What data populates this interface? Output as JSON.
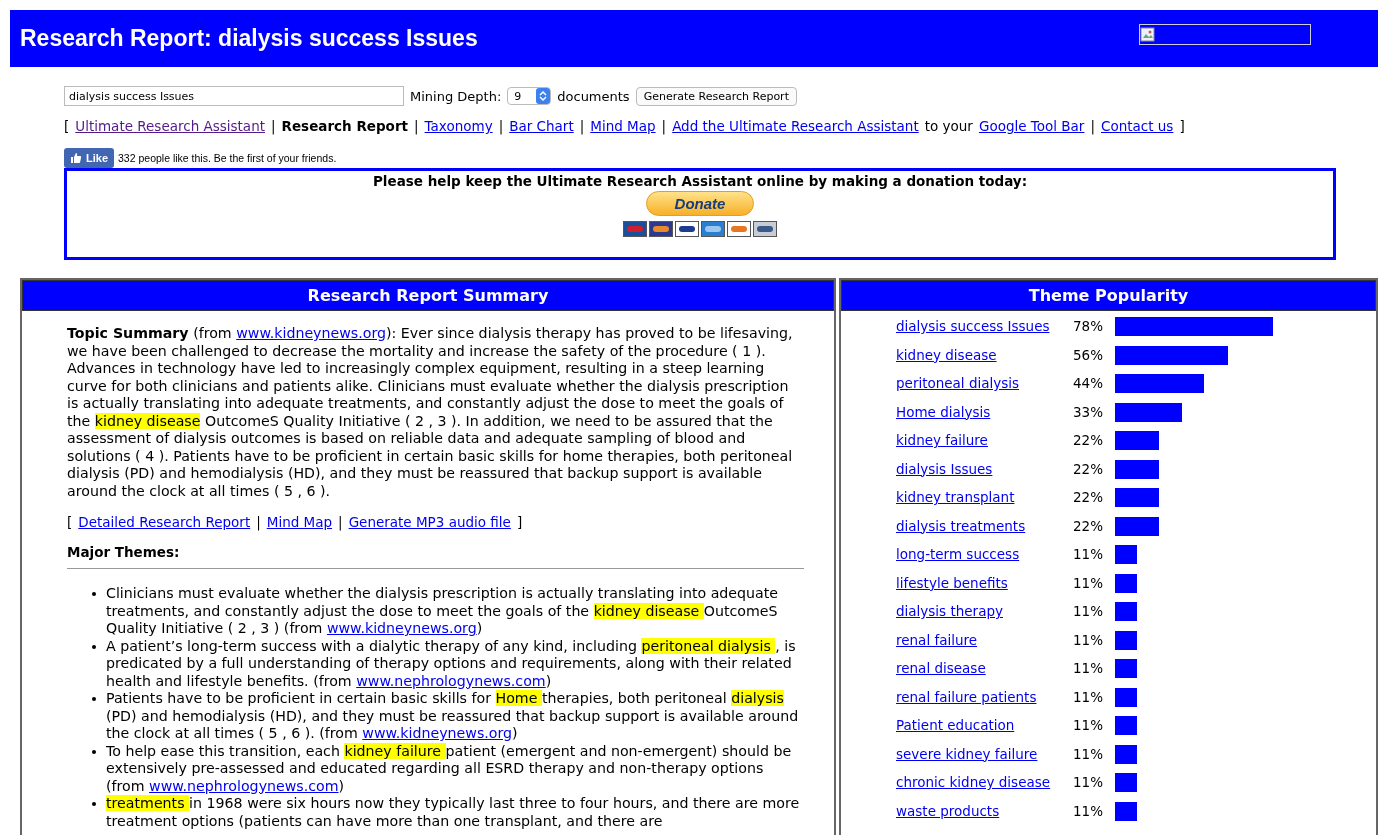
{
  "header": {
    "title": "Research Report: dialysis success Issues"
  },
  "search_form": {
    "query": "dialysis success Issues",
    "depth_label": "Mining Depth:",
    "depth_value": "9",
    "depth_unit": "documents",
    "submit": "Generate Research Report"
  },
  "nav": [
    {
      "label": "[",
      "kind": "separator"
    },
    {
      "label": "Ultimate Research Assistant",
      "kind": "link",
      "visited": true
    },
    {
      "label": "|",
      "kind": "separator"
    },
    {
      "label": "Research Report",
      "kind": "current"
    },
    {
      "label": "|",
      "kind": "separator"
    },
    {
      "label": "Taxonomy",
      "kind": "link",
      "visited": false
    },
    {
      "label": "|",
      "kind": "separator"
    },
    {
      "label": "Bar Chart",
      "kind": "link",
      "visited": false
    },
    {
      "label": "|",
      "kind": "separator"
    },
    {
      "label": "Mind Map",
      "kind": "link",
      "visited": false
    },
    {
      "label": "|",
      "kind": "separator"
    },
    {
      "label": "Add the Ultimate Research Assistant",
      "kind": "link",
      "visited": false
    },
    {
      "label": "to your",
      "kind": "text"
    },
    {
      "label": "Google Tool Bar",
      "kind": "link",
      "visited": false
    },
    {
      "label": "|",
      "kind": "separator"
    },
    {
      "label": "Contact us",
      "kind": "link",
      "visited": false
    },
    {
      "label": "]",
      "kind": "separator"
    }
  ],
  "like": {
    "button": "Like",
    "text": "332 people like this. Be the first of your friends."
  },
  "donation": {
    "message": "Please help keep the Ultimate Research Assistant online by making a donation today:",
    "button": "Donate"
  },
  "summary_panel": {
    "title": "Research Report Summary",
    "topic_summary": [
      {
        "kind": "bold",
        "text": "Topic Summary"
      },
      {
        "kind": "text",
        "text": " (from "
      },
      {
        "kind": "link",
        "text": "www.kidneynews.org"
      },
      {
        "kind": "text",
        "text": "): Ever since dialysis therapy has proved to be lifesaving, we have been challenged to decrease the mortality and increase the safety of the procedure ( 1 ). Advances in technology have led to increasingly complex equipment, resulting in a steep learning curve for both clinicians and patients alike. Clinicians must evaluate whether the dialysis prescription is actually translating into adequate treatments, and constantly adjust the dose to meet the goals of the "
      },
      {
        "kind": "highlight",
        "text": "kidney disease"
      },
      {
        "kind": "text",
        "text": " OutcomeS Quality Initiative ( 2 , 3 ). In addition, we need to be assured that the assessment of dialysis outcomes is based on reliable data and adequate sampling of blood and solutions ( 4 ). Patients have to be proficient in certain basic skills for home therapies, both peritoneal dialysis (PD) and hemodialysis (HD), and they must be reassured that backup support is available around the clock at all times ( 5 , 6 )."
      }
    ],
    "links": [
      {
        "label": "[",
        "kind": "separator"
      },
      {
        "label": "Detailed Research Report",
        "kind": "link"
      },
      {
        "label": "|",
        "kind": "separator"
      },
      {
        "label": "Mind Map",
        "kind": "link"
      },
      {
        "label": "|",
        "kind": "separator"
      },
      {
        "label": "Generate MP3 audio file",
        "kind": "link"
      },
      {
        "label": "]",
        "kind": "separator"
      }
    ],
    "themes_heading": "Major Themes:",
    "themes": [
      [
        {
          "kind": "text",
          "text": "Clinicians must evaluate whether the dialysis prescription is actually translating into adequate treatments, and constantly adjust the dose to meet the goals of the "
        },
        {
          "kind": "highlight",
          "text": "kidney disease "
        },
        {
          "kind": "text",
          "text": "OutcomeS Quality Initiative ( 2 , 3 ) (from "
        },
        {
          "kind": "link",
          "text": "www.kidneynews.org"
        },
        {
          "kind": "text",
          "text": ")"
        }
      ],
      [
        {
          "kind": "text",
          "text": "A patient’s long-term success with a dialytic therapy of any kind, including "
        },
        {
          "kind": "highlight",
          "text": "peritoneal dialysis "
        },
        {
          "kind": "text",
          "text": ", is predicated by a full understanding of therapy options and requirements, along with their related health and lifestyle benefits. (from "
        },
        {
          "kind": "link",
          "text": "www.nephrologynews.com"
        },
        {
          "kind": "text",
          "text": ")"
        }
      ],
      [
        {
          "kind": "text",
          "text": "Patients have to be proficient in certain basic skills for "
        },
        {
          "kind": "highlight",
          "text": "Home "
        },
        {
          "kind": "text",
          "text": "therapies, both peritoneal "
        },
        {
          "kind": "highlight",
          "text": "dialysis "
        },
        {
          "kind": "text",
          "text": "(PD) and hemodialysis (HD), and they must be reassured that backup support is available around the clock at all times ( 5 , 6 ). (from "
        },
        {
          "kind": "link",
          "text": "www.kidneynews.org"
        },
        {
          "kind": "text",
          "text": ")"
        }
      ],
      [
        {
          "kind": "text",
          "text": "To help ease this transition, each "
        },
        {
          "kind": "highlight",
          "text": "kidney failure "
        },
        {
          "kind": "text",
          "text": "patient (emergent and non-emergent) should be extensively pre-assessed and educated regarding all ESRD therapy and non-therapy options (from "
        },
        {
          "kind": "link",
          "text": "www.nephrologynews.com"
        },
        {
          "kind": "text",
          "text": ")"
        }
      ],
      [
        {
          "kind": "highlight",
          "text": "treatments "
        },
        {
          "kind": "text",
          "text": "in 1968 were six hours now they typically last three to four hours, and there are more treatment options (patients can have more than one transplant, and there are"
        }
      ]
    ]
  },
  "theme_panel": {
    "title": "Theme Popularity",
    "themes": [
      {
        "label": "dialysis success Issues",
        "percent": "78%",
        "level": 0.78
      },
      {
        "label": "kidney disease",
        "percent": "56%",
        "level": 0.56
      },
      {
        "label": "peritoneal dialysis",
        "percent": "44%",
        "level": 0.44
      },
      {
        "label": "Home dialysis",
        "percent": "33%",
        "level": 0.33
      },
      {
        "label": "kidney failure",
        "percent": "22%",
        "level": 0.22
      },
      {
        "label": "dialysis Issues",
        "percent": "22%",
        "level": 0.22
      },
      {
        "label": "kidney transplant",
        "percent": "22%",
        "level": 0.22
      },
      {
        "label": "dialysis treatments",
        "percent": "22%",
        "level": 0.22
      },
      {
        "label": "long-term success",
        "percent": "11%",
        "level": 0.11
      },
      {
        "label": "lifestyle benefits",
        "percent": "11%",
        "level": 0.11
      },
      {
        "label": "dialysis therapy",
        "percent": "11%",
        "level": 0.11
      },
      {
        "label": "renal failure",
        "percent": "11%",
        "level": 0.11
      },
      {
        "label": "renal disease",
        "percent": "11%",
        "level": 0.11
      },
      {
        "label": "renal failure patients",
        "percent": "11%",
        "level": 0.11
      },
      {
        "label": "Patient education",
        "percent": "11%",
        "level": 0.11
      },
      {
        "label": "severe kidney failure",
        "percent": "11%",
        "level": 0.11
      },
      {
        "label": "chronic kidney disease",
        "percent": "11%",
        "level": 0.11
      },
      {
        "label": "waste products",
        "percent": "11%",
        "level": 0.11
      }
    ]
  }
}
